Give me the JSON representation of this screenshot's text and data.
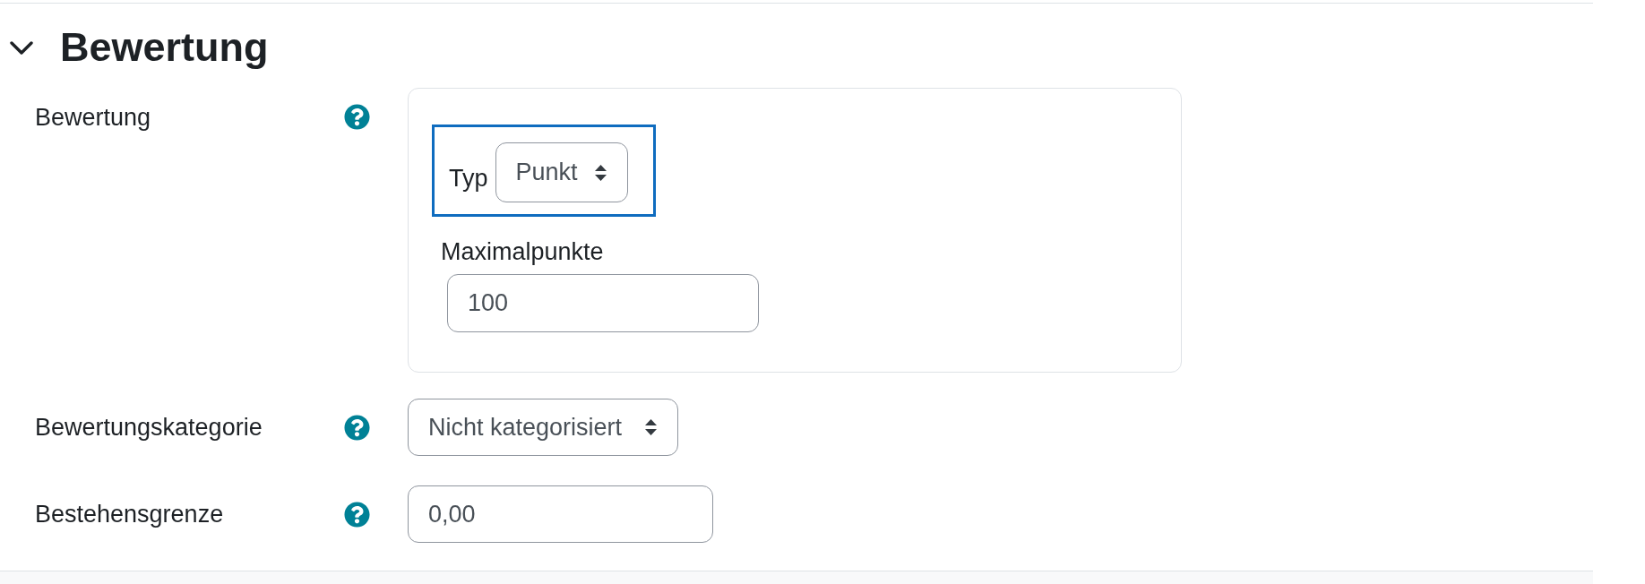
{
  "section": {
    "title": "Bewertung",
    "expanded": true
  },
  "fields": [
    {
      "kind": "group",
      "label": "Bewertung",
      "children": [
        {
          "kind": "select",
          "label": "Typ",
          "value": "Punkt",
          "focused": true
        },
        {
          "kind": "text",
          "label": "Maximalpunkte",
          "value": "100",
          "focused": false
        }
      ]
    },
    {
      "kind": "select",
      "label": "Bewertungskategorie",
      "value": "Nicht kategorisiert"
    },
    {
      "kind": "text",
      "label": "Bestehensgrenze",
      "value": "0,00"
    }
  ]
}
